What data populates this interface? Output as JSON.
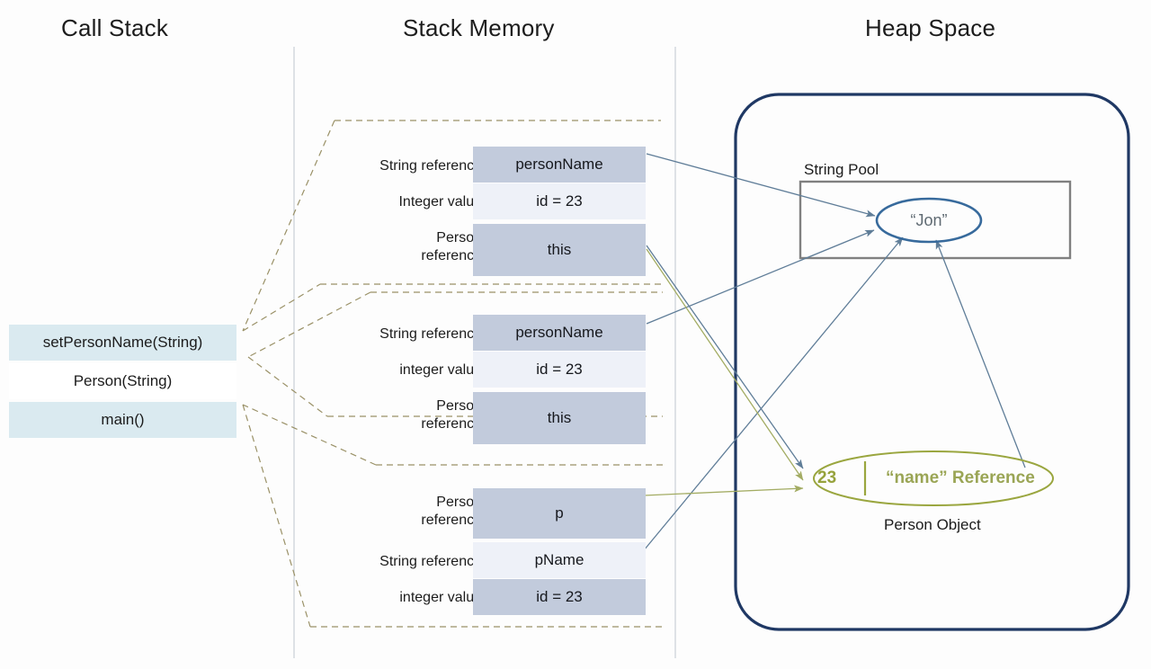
{
  "columns": {
    "call_stack_title": "Call Stack",
    "stack_memory_title": "Stack Memory",
    "heap_space_title": "Heap Space"
  },
  "call_stack": {
    "frames": [
      {
        "label": "setPersonName(String)",
        "filled": true
      },
      {
        "label": "Person(String)",
        "filled": false
      },
      {
        "label": "main()",
        "filled": true
      }
    ]
  },
  "stack_memory": {
    "frames": [
      {
        "name": "setPersonName-frame",
        "rows": [
          {
            "label": "String reference",
            "value": "personName",
            "shade": "dark"
          },
          {
            "label": "Integer value",
            "value": "id = 23",
            "shade": "light"
          },
          {
            "label": "Person\nreference",
            "value": "this",
            "shade": "dark"
          }
        ]
      },
      {
        "name": "person-constructor-frame",
        "rows": [
          {
            "label": "String reference",
            "value": "personName",
            "shade": "dark"
          },
          {
            "label": "integer value",
            "value": "id = 23",
            "shade": "light"
          },
          {
            "label": "Person\nreference",
            "value": "this",
            "shade": "dark"
          }
        ]
      },
      {
        "name": "main-frame",
        "rows": [
          {
            "label": "Person\nreference",
            "value": "p",
            "shade": "dark"
          },
          {
            "label": "String reference",
            "value": "pName",
            "shade": "light"
          },
          {
            "label": "integer value",
            "value": "id = 23",
            "shade": "dark"
          }
        ]
      }
    ]
  },
  "heap": {
    "string_pool_label": "String Pool",
    "string_literal": "“Jon”",
    "person_object": {
      "id_value": "23",
      "name_reference": "“name” Reference",
      "caption": "Person Object"
    }
  },
  "colors": {
    "call_stack_fill": "#daeaf0",
    "cell_dark": "#c2cbdc",
    "cell_light": "#eef1f8",
    "heap_border": "#1f3864",
    "string_pool_border": "#808080",
    "string_oval": "#376a9c",
    "person_oval": "#9aa63f",
    "callout_dash": "#9a9167",
    "arrow_blue": "#5f7d98",
    "arrow_olive": "#a3ac63",
    "divider": "#c9cfd6"
  }
}
